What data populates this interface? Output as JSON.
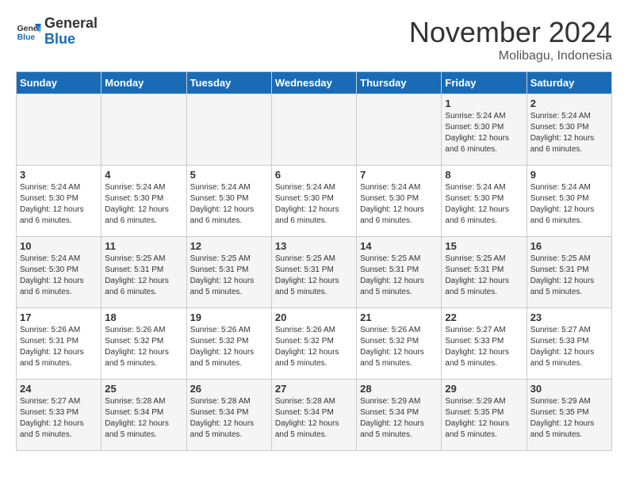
{
  "header": {
    "logo_general": "General",
    "logo_blue": "Blue",
    "month_title": "November 2024",
    "location": "Molibagu, Indonesia"
  },
  "days_of_week": [
    "Sunday",
    "Monday",
    "Tuesday",
    "Wednesday",
    "Thursday",
    "Friday",
    "Saturday"
  ],
  "weeks": [
    [
      {
        "day": "",
        "info": ""
      },
      {
        "day": "",
        "info": ""
      },
      {
        "day": "",
        "info": ""
      },
      {
        "day": "",
        "info": ""
      },
      {
        "day": "",
        "info": ""
      },
      {
        "day": "1",
        "info": "Sunrise: 5:24 AM\nSunset: 5:30 PM\nDaylight: 12 hours and 6 minutes."
      },
      {
        "day": "2",
        "info": "Sunrise: 5:24 AM\nSunset: 5:30 PM\nDaylight: 12 hours and 6 minutes."
      }
    ],
    [
      {
        "day": "3",
        "info": "Sunrise: 5:24 AM\nSunset: 5:30 PM\nDaylight: 12 hours and 6 minutes."
      },
      {
        "day": "4",
        "info": "Sunrise: 5:24 AM\nSunset: 5:30 PM\nDaylight: 12 hours and 6 minutes."
      },
      {
        "day": "5",
        "info": "Sunrise: 5:24 AM\nSunset: 5:30 PM\nDaylight: 12 hours and 6 minutes."
      },
      {
        "day": "6",
        "info": "Sunrise: 5:24 AM\nSunset: 5:30 PM\nDaylight: 12 hours and 6 minutes."
      },
      {
        "day": "7",
        "info": "Sunrise: 5:24 AM\nSunset: 5:30 PM\nDaylight: 12 hours and 6 minutes."
      },
      {
        "day": "8",
        "info": "Sunrise: 5:24 AM\nSunset: 5:30 PM\nDaylight: 12 hours and 6 minutes."
      },
      {
        "day": "9",
        "info": "Sunrise: 5:24 AM\nSunset: 5:30 PM\nDaylight: 12 hours and 6 minutes."
      }
    ],
    [
      {
        "day": "10",
        "info": "Sunrise: 5:24 AM\nSunset: 5:30 PM\nDaylight: 12 hours and 6 minutes."
      },
      {
        "day": "11",
        "info": "Sunrise: 5:25 AM\nSunset: 5:31 PM\nDaylight: 12 hours and 6 minutes."
      },
      {
        "day": "12",
        "info": "Sunrise: 5:25 AM\nSunset: 5:31 PM\nDaylight: 12 hours and 5 minutes."
      },
      {
        "day": "13",
        "info": "Sunrise: 5:25 AM\nSunset: 5:31 PM\nDaylight: 12 hours and 5 minutes."
      },
      {
        "day": "14",
        "info": "Sunrise: 5:25 AM\nSunset: 5:31 PM\nDaylight: 12 hours and 5 minutes."
      },
      {
        "day": "15",
        "info": "Sunrise: 5:25 AM\nSunset: 5:31 PM\nDaylight: 12 hours and 5 minutes."
      },
      {
        "day": "16",
        "info": "Sunrise: 5:25 AM\nSunset: 5:31 PM\nDaylight: 12 hours and 5 minutes."
      }
    ],
    [
      {
        "day": "17",
        "info": "Sunrise: 5:26 AM\nSunset: 5:31 PM\nDaylight: 12 hours and 5 minutes."
      },
      {
        "day": "18",
        "info": "Sunrise: 5:26 AM\nSunset: 5:32 PM\nDaylight: 12 hours and 5 minutes."
      },
      {
        "day": "19",
        "info": "Sunrise: 5:26 AM\nSunset: 5:32 PM\nDaylight: 12 hours and 5 minutes."
      },
      {
        "day": "20",
        "info": "Sunrise: 5:26 AM\nSunset: 5:32 PM\nDaylight: 12 hours and 5 minutes."
      },
      {
        "day": "21",
        "info": "Sunrise: 5:26 AM\nSunset: 5:32 PM\nDaylight: 12 hours and 5 minutes."
      },
      {
        "day": "22",
        "info": "Sunrise: 5:27 AM\nSunset: 5:33 PM\nDaylight: 12 hours and 5 minutes."
      },
      {
        "day": "23",
        "info": "Sunrise: 5:27 AM\nSunset: 5:33 PM\nDaylight: 12 hours and 5 minutes."
      }
    ],
    [
      {
        "day": "24",
        "info": "Sunrise: 5:27 AM\nSunset: 5:33 PM\nDaylight: 12 hours and 5 minutes."
      },
      {
        "day": "25",
        "info": "Sunrise: 5:28 AM\nSunset: 5:34 PM\nDaylight: 12 hours and 5 minutes."
      },
      {
        "day": "26",
        "info": "Sunrise: 5:28 AM\nSunset: 5:34 PM\nDaylight: 12 hours and 5 minutes."
      },
      {
        "day": "27",
        "info": "Sunrise: 5:28 AM\nSunset: 5:34 PM\nDaylight: 12 hours and 5 minutes."
      },
      {
        "day": "28",
        "info": "Sunrise: 5:29 AM\nSunset: 5:34 PM\nDaylight: 12 hours and 5 minutes."
      },
      {
        "day": "29",
        "info": "Sunrise: 5:29 AM\nSunset: 5:35 PM\nDaylight: 12 hours and 5 minutes."
      },
      {
        "day": "30",
        "info": "Sunrise: 5:29 AM\nSunset: 5:35 PM\nDaylight: 12 hours and 5 minutes."
      }
    ]
  ]
}
